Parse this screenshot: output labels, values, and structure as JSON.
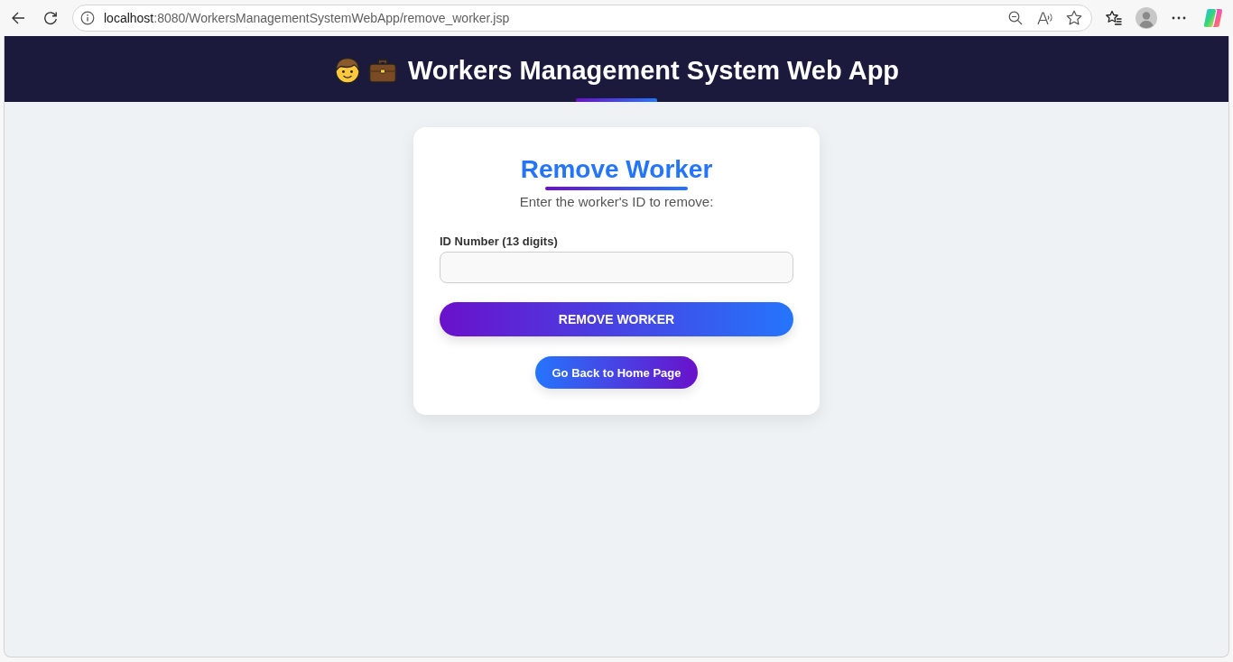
{
  "browser": {
    "url": {
      "host": "localhost",
      "path": ":8080/WorkersManagementSystemWebApp/remove_worker.jsp"
    }
  },
  "header": {
    "title": "Workers Management System Web App"
  },
  "form": {
    "title": "Remove Worker",
    "subtitle": "Enter the worker's ID to remove:",
    "field": {
      "label": "ID Number (13 digits)"
    },
    "submit": "REMOVE WORKER",
    "back_link": "Go Back to Home Page"
  }
}
